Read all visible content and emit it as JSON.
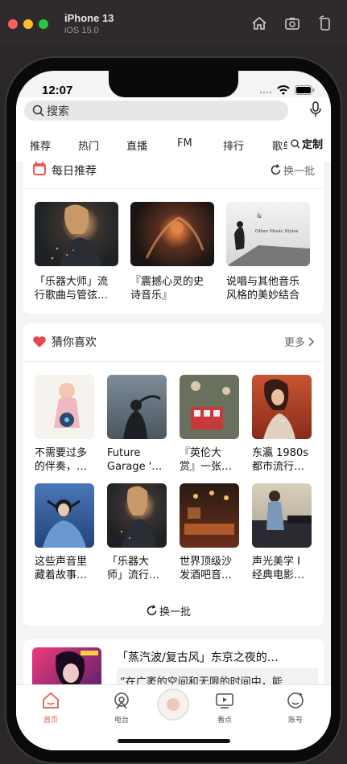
{
  "simulator": {
    "device": "iPhone 13",
    "os": "iOS 15.0"
  },
  "status": {
    "time": "12:07"
  },
  "search": {
    "placeholder": "搜索"
  },
  "tabs": [
    "推荐",
    "热门",
    "直播",
    "FM",
    "排行",
    "歌单"
  ],
  "tab_custom": "定制",
  "daily": {
    "title": "每日推荐",
    "action": "换一批",
    "items": [
      {
        "line1": "「乐器大师」流",
        "line2": "行歌曲与管弦…"
      },
      {
        "line1": "『震撼心灵的史",
        "line2": "诗音乐』"
      },
      {
        "line1": "说唱与其他音乐",
        "line2": "风格的美妙结合",
        "cover_text1": "&",
        "cover_text2": "Other Music Styles"
      }
    ]
  },
  "guess": {
    "title": "猜你喜欢",
    "more": "更多",
    "refresh": "换一批",
    "items": [
      {
        "line1": "不需要过多",
        "line2": "的伴奏，…"
      },
      {
        "line1": "Future",
        "line2": "Garage '…"
      },
      {
        "line1": "『英伦大",
        "line2": "赏』一张…"
      },
      {
        "line1": "东瀛 1980s",
        "line2": "都市流行…"
      },
      {
        "line1": "这些声音里",
        "line2": "藏着故事…"
      },
      {
        "line1": "「乐器大",
        "line2": "师」流行…"
      },
      {
        "line1": "世界顶级沙",
        "line2": "发酒吧音…"
      },
      {
        "line1": "声光美学 I",
        "line2": "经典电影…"
      }
    ]
  },
  "feature": {
    "title": "「蒸汽波/复古风」东京之夜的…",
    "quote": "“在广袤的空间和无限的时间中，能"
  },
  "tabbar": [
    {
      "label": "首页",
      "icon": "home-icon",
      "active": true
    },
    {
      "label": "电台",
      "icon": "radio-icon",
      "active": false
    },
    {
      "label": "",
      "icon": "player-disc-icon",
      "active": false
    },
    {
      "label": "看点",
      "icon": "video-icon",
      "active": false
    },
    {
      "label": "账号",
      "icon": "account-icon",
      "active": false
    }
  ],
  "colors": {
    "accent": "#e85a4f",
    "heart": "#e8464f"
  }
}
